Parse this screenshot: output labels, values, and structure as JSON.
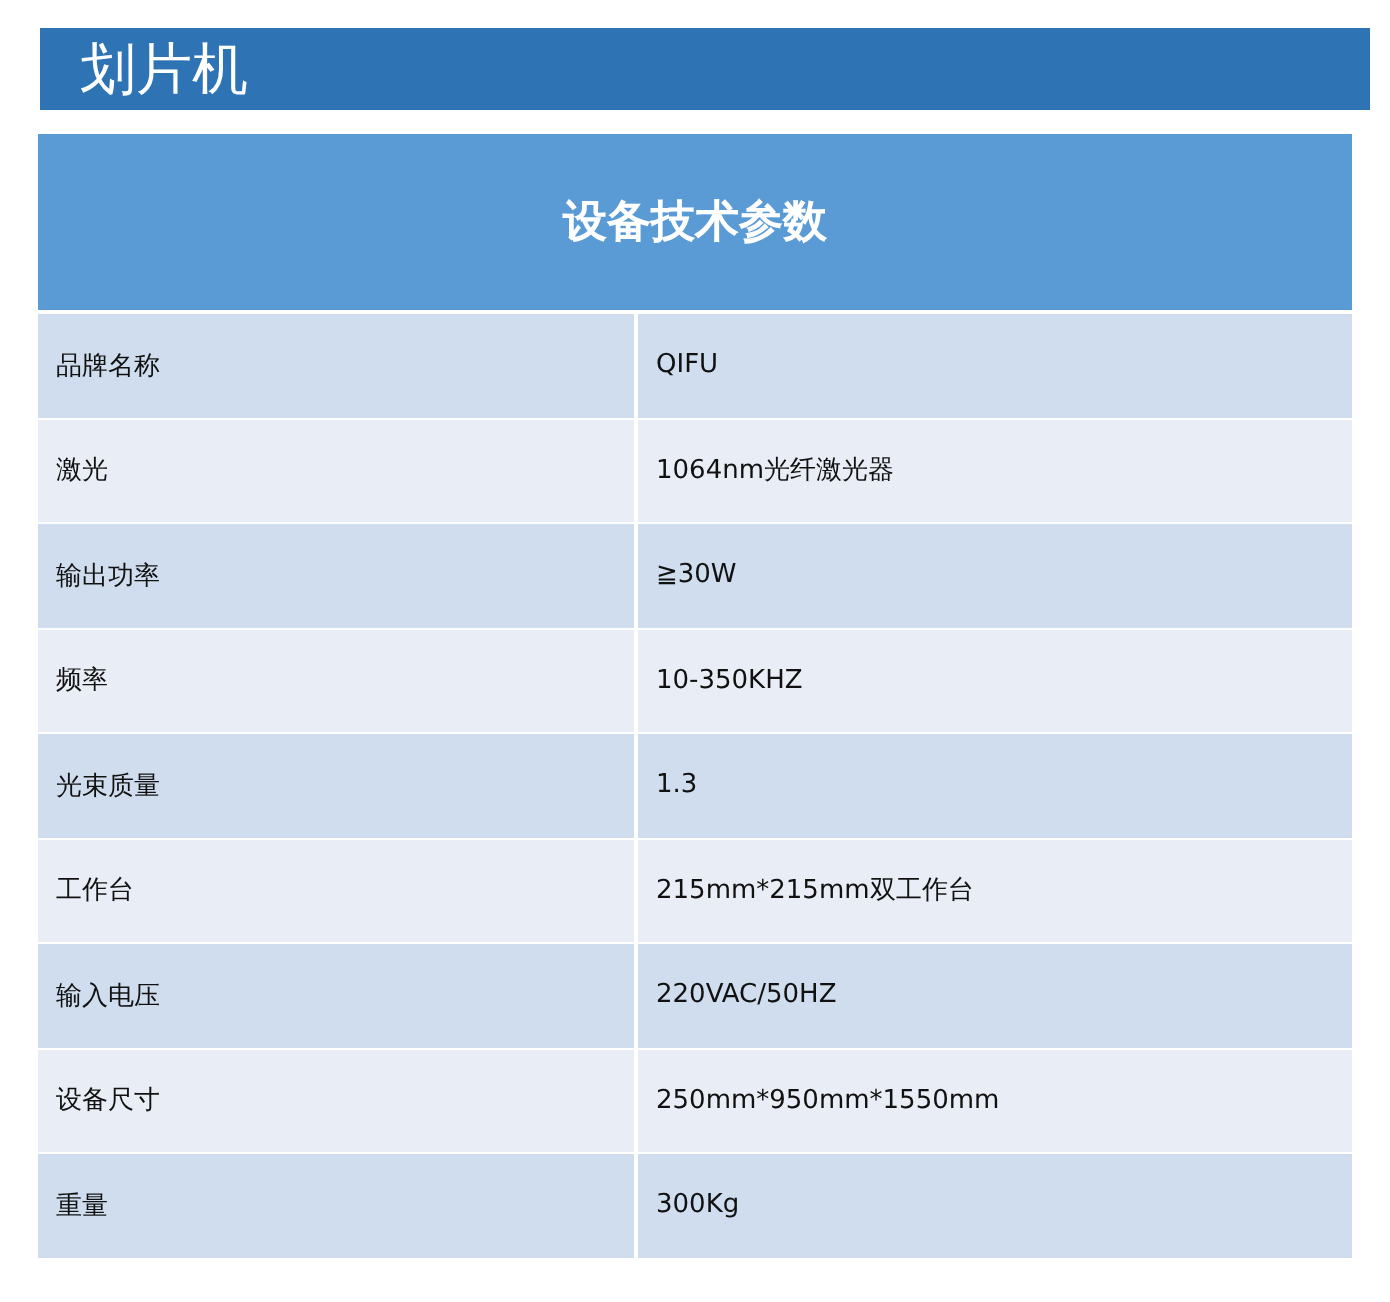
{
  "title": "划片机",
  "table": {
    "heading": "设备技术参数",
    "rows": [
      {
        "name": "品牌名称",
        "value": "QIFU"
      },
      {
        "name": "激光",
        "value": "1064nm光纤激光器"
      },
      {
        "name": "输出功率",
        "value": "≧30W"
      },
      {
        "name": "频率",
        "value": "10-350KHZ"
      },
      {
        "name": "光束质量",
        "value": "1.3"
      },
      {
        "name": "工作台",
        "value": "215mm*215mm双工作台"
      },
      {
        "name": "输入电压",
        "value": "220VAC/50HZ"
      },
      {
        "name": "设备尺寸",
        "value": "250mm*950mm*1550mm"
      },
      {
        "name": "重量",
        "value": "300Kg"
      }
    ]
  }
}
